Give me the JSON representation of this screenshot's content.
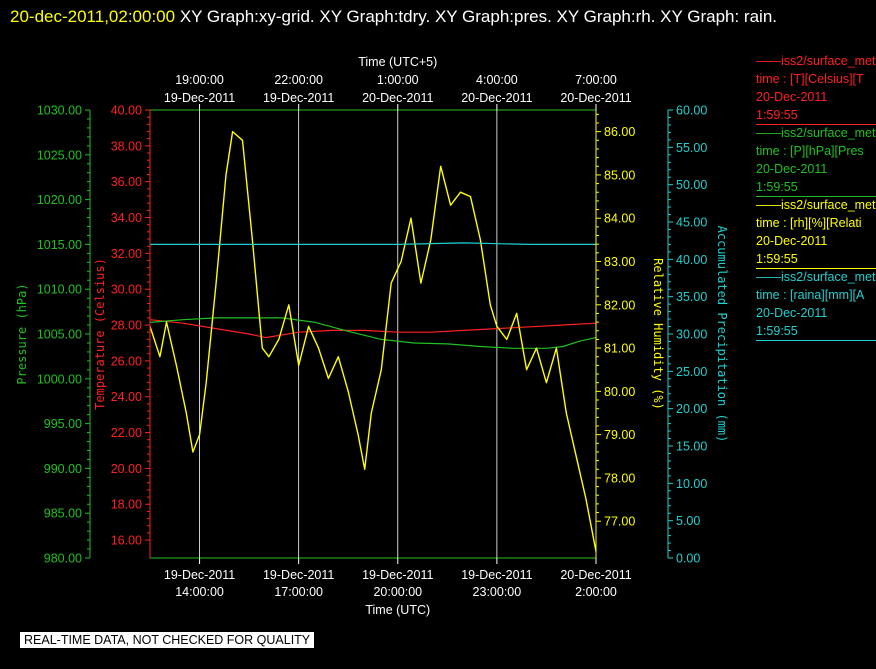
{
  "title": {
    "timestamp": "20-dec-2011,02:00:00",
    "text": "  XY Graph:xy-grid.  XY Graph:tdry.  XY Graph:pres.  XY Graph:rh.  XY Graph: rain."
  },
  "colors": {
    "background": "#000000",
    "temperature": "#ff2020",
    "pressure": "#20c020",
    "humidity": "#ffff00",
    "precipitation": "#20d0d0",
    "grid": "#ffffff",
    "timestamp": "#ffff00"
  },
  "legend": [
    {
      "line1": "——iss2/surface_met",
      "line2": "time : [T][Celsius][T",
      "line3": "20-Dec-2011",
      "line4": "1:59:55",
      "color": "#ff2020"
    },
    {
      "line1": "——iss2/surface_met",
      "line2": "time : [P][hPa][Pres",
      "line3": "20-Dec-2011",
      "line4": "1:59:55",
      "color": "#20c020"
    },
    {
      "line1": "——iss2/surface_met",
      "line2": "time : [rh][%][Relati",
      "line3": "20-Dec-2011",
      "line4": "1:59:55",
      "color": "#ffff00"
    },
    {
      "line1": "——iss2/surface_met",
      "line2": "time : [raina][mm][A",
      "line3": "20-Dec-2011",
      "line4": "1:59:55",
      "color": "#20d0d0"
    }
  ],
  "footer": "REAL-TIME DATA, NOT CHECKED FOR QUALITY",
  "chart_data": {
    "type": "line",
    "grid": true,
    "x_top_label": "Time (UTC+5)",
    "x_bottom_label": "Time (UTC)",
    "x_range": [
      12.5,
      26.0
    ],
    "x_bottom_ticks": [
      {
        "x": 14,
        "date": "19-Dec-2011",
        "time": "14:00:00"
      },
      {
        "x": 17,
        "date": "19-Dec-2011",
        "time": "17:00:00"
      },
      {
        "x": 20,
        "date": "19-Dec-2011",
        "time": "20:00:00"
      },
      {
        "x": 23,
        "date": "19-Dec-2011",
        "time": "23:00:00"
      },
      {
        "x": 26,
        "date": "20-Dec-2011",
        "time": "2:00:00"
      }
    ],
    "x_top_ticks": [
      {
        "x": 14,
        "time": "19:00:00",
        "date": "19-Dec-2011"
      },
      {
        "x": 17,
        "time": "22:00:00",
        "date": "19-Dec-2011"
      },
      {
        "x": 20,
        "time": "1:00:00",
        "date": "20-Dec-2011"
      },
      {
        "x": 23,
        "time": "4:00:00",
        "date": "20-Dec-2011"
      },
      {
        "x": 26,
        "time": "7:00:00",
        "date": "20-Dec-2011"
      }
    ],
    "axes": {
      "pressure": {
        "label": "Pressure (hPa)",
        "range": [
          980,
          1030
        ],
        "ticks": [
          "980.00",
          "985.00",
          "990.00",
          "995.00",
          "1000.00",
          "1005.00",
          "1010.00",
          "1015.00",
          "1020.00",
          "1025.00",
          "1030.00"
        ],
        "color": "#20c020"
      },
      "temperature": {
        "label": "Temperature (Celsius)",
        "range": [
          15,
          40
        ],
        "ticks": [
          "16.00",
          "18.00",
          "20.00",
          "22.00",
          "24.00",
          "26.00",
          "28.00",
          "30.00",
          "32.00",
          "34.00",
          "36.00",
          "38.00",
          "40.00"
        ],
        "color": "#ff2020"
      },
      "humidity": {
        "label": "Relative Humidity (%)",
        "range": [
          76.15,
          86.5
        ],
        "ticks": [
          "77.00",
          "78.00",
          "79.00",
          "80.00",
          "81.00",
          "82.00",
          "83.00",
          "84.00",
          "85.00",
          "86.00"
        ],
        "color": "#ffff00"
      },
      "precipitation": {
        "label": "Accumulated Precipitation (mm)",
        "range": [
          0,
          60
        ],
        "ticks": [
          "0.00",
          "5.00",
          "10.00",
          "15.00",
          "20.00",
          "25.00",
          "30.00",
          "35.00",
          "40.00",
          "45.00",
          "50.00",
          "55.00",
          "60.00"
        ],
        "color": "#20d0d0"
      }
    },
    "series": [
      {
        "name": "iss2/surface_met T",
        "axis": "temperature",
        "color": "#ff2020",
        "x": [
          12.5,
          13.5,
          14.5,
          15.5,
          16.0,
          17.0,
          18.0,
          19.0,
          20.0,
          21.0,
          22.0,
          23.0,
          24.0,
          25.0,
          26.0
        ],
        "y": [
          28.3,
          28.1,
          27.8,
          27.5,
          27.3,
          27.6,
          27.7,
          27.7,
          27.6,
          27.6,
          27.7,
          27.8,
          27.9,
          28.0,
          28.1
        ]
      },
      {
        "name": "iss2/surface_met P",
        "axis": "pressure",
        "color": "#20c020",
        "x": [
          12.5,
          13.5,
          14.5,
          15.5,
          16.5,
          17.5,
          18.5,
          19.5,
          20.5,
          21.5,
          22.5,
          23.5,
          24.5,
          25.0,
          25.5,
          26.0
        ],
        "y": [
          1006.3,
          1006.6,
          1006.8,
          1006.8,
          1006.8,
          1006.3,
          1005.3,
          1004.4,
          1004.0,
          1003.9,
          1003.6,
          1003.4,
          1003.4,
          1003.6,
          1004.2,
          1004.6
        ]
      },
      {
        "name": "iss2/surface_met rh",
        "axis": "humidity",
        "color": "#ffff00",
        "x": [
          12.5,
          12.8,
          13.0,
          13.3,
          13.6,
          13.8,
          14.0,
          14.2,
          14.5,
          14.8,
          15.0,
          15.3,
          15.6,
          15.9,
          16.1,
          16.4,
          16.7,
          17.0,
          17.3,
          17.6,
          17.9,
          18.2,
          18.5,
          18.8,
          19.0,
          19.2,
          19.5,
          19.8,
          20.1,
          20.4,
          20.7,
          21.0,
          21.3,
          21.6,
          21.9,
          22.2,
          22.5,
          22.8,
          23.0,
          23.3,
          23.6,
          23.9,
          24.2,
          24.5,
          24.8,
          25.1,
          25.4,
          25.7,
          26.0
        ],
        "y": [
          81.5,
          80.8,
          81.6,
          80.6,
          79.5,
          78.6,
          79.0,
          80.2,
          82.5,
          85.0,
          86.0,
          85.8,
          83.5,
          81.0,
          80.8,
          81.2,
          82.0,
          80.6,
          81.5,
          81.0,
          80.3,
          80.8,
          80.0,
          79.0,
          78.2,
          79.5,
          80.5,
          82.5,
          83.0,
          84.0,
          82.5,
          83.5,
          85.2,
          84.3,
          84.6,
          84.5,
          83.5,
          82.0,
          81.5,
          81.2,
          81.8,
          80.5,
          81.0,
          80.2,
          81.0,
          79.5,
          78.5,
          77.5,
          76.3
        ]
      },
      {
        "name": "iss2/surface_met raina",
        "axis": "precipitation",
        "color": "#20d0d0",
        "x": [
          12.5,
          18.0,
          20.0,
          22.0,
          24.0,
          26.0
        ],
        "y": [
          42.0,
          42.0,
          42.0,
          42.2,
          42.0,
          42.0
        ]
      }
    ]
  }
}
